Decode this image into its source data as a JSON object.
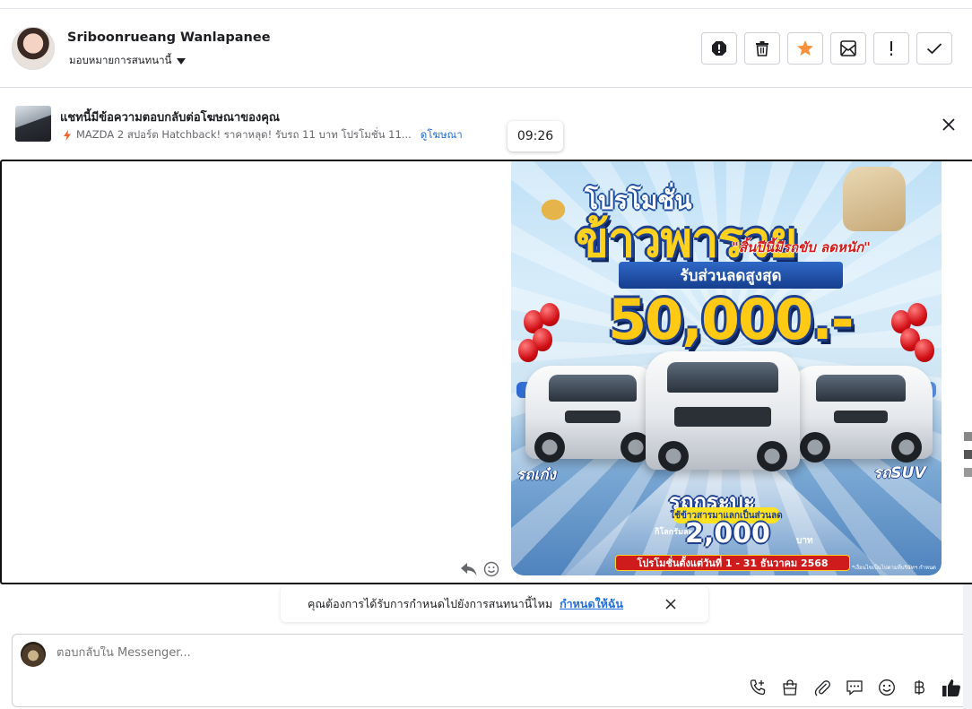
{
  "header": {
    "user_name": "Sriboonrueang Wanlapanee",
    "assign_label": "มอบหมายการสนทนานี้",
    "actions": [
      "report-icon",
      "trash-icon",
      "star-icon",
      "mail-unread-icon",
      "exclamation-icon",
      "check-icon"
    ],
    "star_color": "#f7923a"
  },
  "ad_banner": {
    "title": "แชทนี้มีข้อความตอบกลับต่อโฆษณาของคุณ",
    "ad_text": "MAZDA 2 สปอร์ต Hatchback! ราคาหลุด! รับรถ 11 บาท โปรโมชั่น 11...",
    "view_ad_link": "ดูโฆษณา",
    "link_color": "#216fdb"
  },
  "message": {
    "timestamp": "09:26",
    "promo": {
      "line1": "โปรโมชั่น",
      "line2": "ข้าวพารวย",
      "line3": "\"สิ้นปีนี้มีรถขับ ลดหนัก\"",
      "ribbon": "รับส่วนลดสูงสุด",
      "amount": "50,000.-",
      "sedan_tag": "รถเก๋ง",
      "suv_tag": "รถSUV",
      "pickup_tag": "รถกระบะ",
      "rice_label": "ใช้ข้าวสารมาแลกเป็นส่วนลด",
      "per_km": "กิโลกรัมละ",
      "price": "2,000",
      "baht": "บาท",
      "period": "โปรโมชั่นตั้งแต่วันที่ 1 - 31 ธันวาคม 2568",
      "note": "*เงื่อนไขเป็นไปตามที่บริษัทฯ กำหนด"
    }
  },
  "reminder": {
    "text": "คุณต้องการได้รับการกำหนดไปยังการสนทนานี้ไหม",
    "link": "กำหนดให้ฉัน"
  },
  "composer": {
    "placeholder": "ตอบกลับใน Messenger...",
    "tools": [
      "call-plus-icon",
      "shopping-bag-icon",
      "paperclip-icon",
      "saved-reply-icon",
      "emoji-icon",
      "baht-icon",
      "thumbs-up-icon"
    ]
  }
}
